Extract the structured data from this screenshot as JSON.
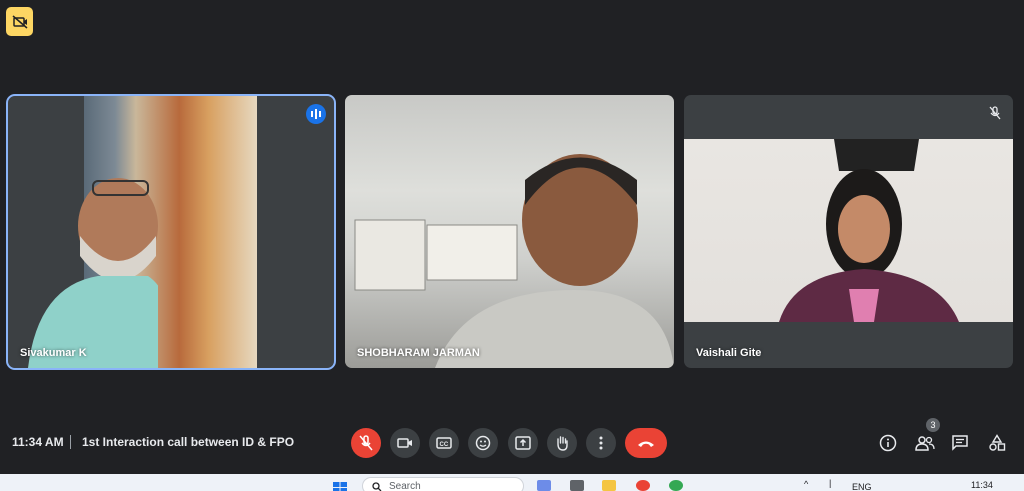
{
  "participants": [
    {
      "name": "Sivakumar K",
      "speaking": true
    },
    {
      "name": "SHOBHARAM JARMAN",
      "speaking": false
    },
    {
      "name": "Vaishali Gite",
      "muted": true
    }
  ],
  "meeting": {
    "time": "11:34 AM",
    "title": "1st Interaction call between ID & FPO"
  },
  "people_count": "3",
  "taskbar": {
    "search_placeholder": "Search",
    "language": "ENG",
    "clock": "11:34"
  },
  "colors": {
    "background": "#202124",
    "accent": "#8ab4f8",
    "end_call": "#ea4335",
    "recording": "#fdd663"
  }
}
